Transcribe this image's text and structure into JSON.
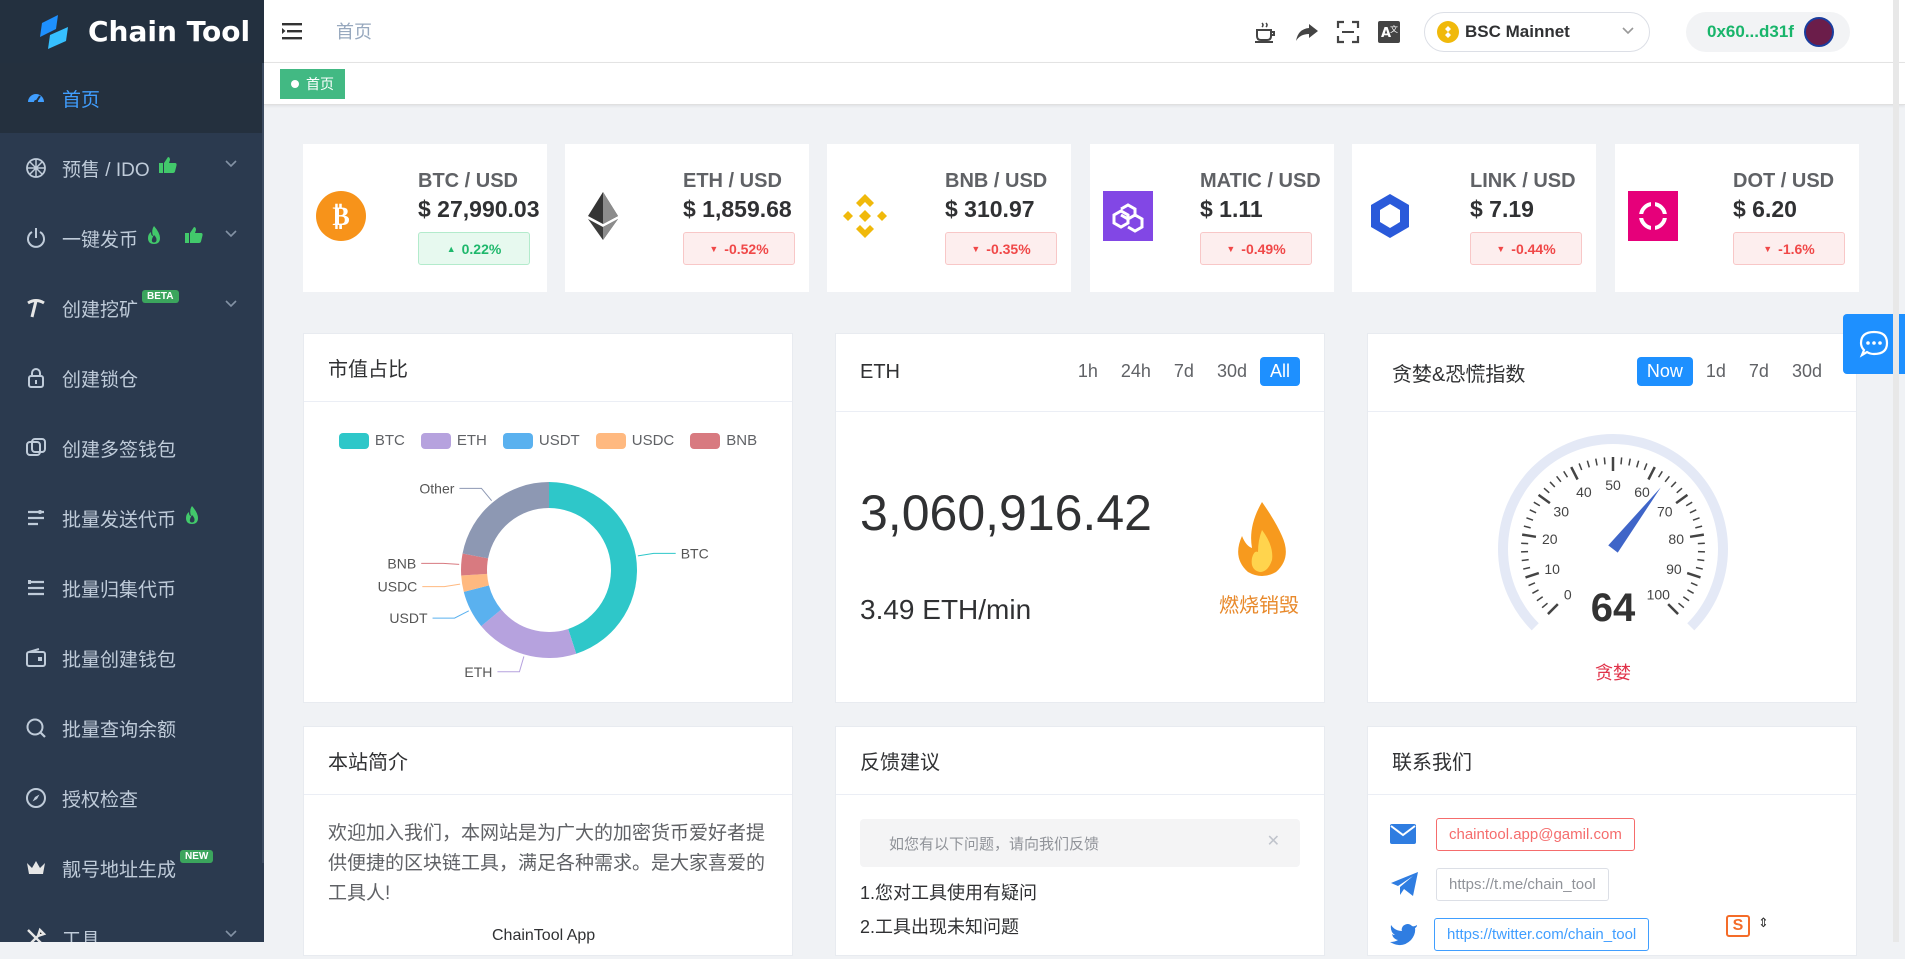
{
  "brand": {
    "name": "Chain Tool",
    "accent": "#409eff",
    "sidebar_bg": "#2b3a4f"
  },
  "sidebar": {
    "items": [
      {
        "label": "首页",
        "icon": "dashboard-icon",
        "active": true
      },
      {
        "label": "预售 / IDO",
        "icon": "ido-icon",
        "badge": "thumbs-up-icon",
        "expandable": true
      },
      {
        "label": "一键发币",
        "icon": "power-icon",
        "badge": "fire-icon",
        "badge2": "thumbs-up-icon",
        "expandable": true
      },
      {
        "label": "创建挖矿",
        "icon": "pickaxe-icon",
        "tag": "BETA",
        "expandable": true
      },
      {
        "label": "创建锁仓",
        "icon": "lock-icon"
      },
      {
        "label": "创建多签钱包",
        "icon": "multisig-icon"
      },
      {
        "label": "批量发送代币",
        "icon": "batch-send-icon",
        "badge": "fire-icon"
      },
      {
        "label": "批量归集代币",
        "icon": "batch-collect-icon"
      },
      {
        "label": "批量创建钱包",
        "icon": "wallet-icon"
      },
      {
        "label": "批量查询余额",
        "icon": "search-icon"
      },
      {
        "label": "授权检查",
        "icon": "compass-icon"
      },
      {
        "label": "靓号地址生成",
        "icon": "crown-icon",
        "tag": "NEW"
      },
      {
        "label": "工具",
        "icon": "tools-icon",
        "expandable": true
      }
    ]
  },
  "navbar": {
    "breadcrumb": "首页",
    "network": "BSC Mainnet",
    "wallet": "0x60...d31f"
  },
  "tags": [
    {
      "label": "首页"
    }
  ],
  "prices": [
    {
      "pair": "BTC / USD",
      "value": "$ 27,990.03",
      "change": "0.22%",
      "dir": "up",
      "icon": "bitcoin-icon"
    },
    {
      "pair": "ETH / USD",
      "value": "$ 1,859.68",
      "change": "-0.52%",
      "dir": "down",
      "icon": "ethereum-icon"
    },
    {
      "pair": "BNB / USD",
      "value": "$ 310.97",
      "change": "-0.35%",
      "dir": "down",
      "icon": "bnb-icon"
    },
    {
      "pair": "MATIC / USD",
      "value": "$ 1.11",
      "change": "-0.49%",
      "dir": "down",
      "icon": "polygon-icon"
    },
    {
      "pair": "LINK / USD",
      "value": "$ 7.19",
      "change": "-0.44%",
      "dir": "down",
      "icon": "chainlink-icon"
    },
    {
      "pair": "DOT / USD",
      "value": "$ 6.20",
      "change": "-1.6%",
      "dir": "down",
      "icon": "polkadot-icon"
    }
  ],
  "market_share": {
    "title": "市值占比",
    "chart_data": {
      "type": "pie",
      "legend": [
        "BTC",
        "ETH",
        "USDT",
        "USDC",
        "BNB"
      ],
      "slices": [
        {
          "label": "BTC",
          "value": 45,
          "color": "#2ec7c9"
        },
        {
          "label": "ETH",
          "value": 19,
          "color": "#b6a2de"
        },
        {
          "label": "USDT",
          "value": 7,
          "color": "#5ab1ef"
        },
        {
          "label": "USDC",
          "value": 3,
          "color": "#ffb980"
        },
        {
          "label": "BNB",
          "value": 4,
          "color": "#d87a80"
        },
        {
          "label": "Other",
          "value": 22,
          "color": "#8d98b3"
        }
      ]
    }
  },
  "eth_burn": {
    "title": "ETH",
    "ranges": [
      "1h",
      "24h",
      "7d",
      "30d",
      "All"
    ],
    "selected": "All",
    "total": "3,060,916.42",
    "rate": "3.49 ETH/min",
    "label": "燃烧销毁"
  },
  "fear_greed": {
    "title": "贪婪&恐慌指数",
    "ranges": [
      "Now",
      "1d",
      "7d",
      "30d"
    ],
    "selected": "Now",
    "value": 64,
    "label": "贪婪",
    "ticks": [
      "0",
      "10",
      "20",
      "30",
      "40",
      "50",
      "60",
      "70",
      "80",
      "90",
      "100"
    ]
  },
  "about": {
    "title": "本站简介",
    "text": "欢迎加入我们，本网站是为广大的加密货币爱好者提供便捷的区块链工具，满足各种需求。是大家喜爱的工具人!",
    "sub": "ChainTool App"
  },
  "feedback": {
    "title": "反馈建议",
    "notice": "如您有以下问题，请向我们反馈",
    "items": [
      "1.您对工具使用有疑问",
      "2.工具出现未知问题"
    ]
  },
  "contact": {
    "title": "联系我们",
    "email": "chaintool.app@gamil.com",
    "telegram": "https://t.me/chain_tool",
    "twitter": "https://twitter.com/chain_tool"
  }
}
